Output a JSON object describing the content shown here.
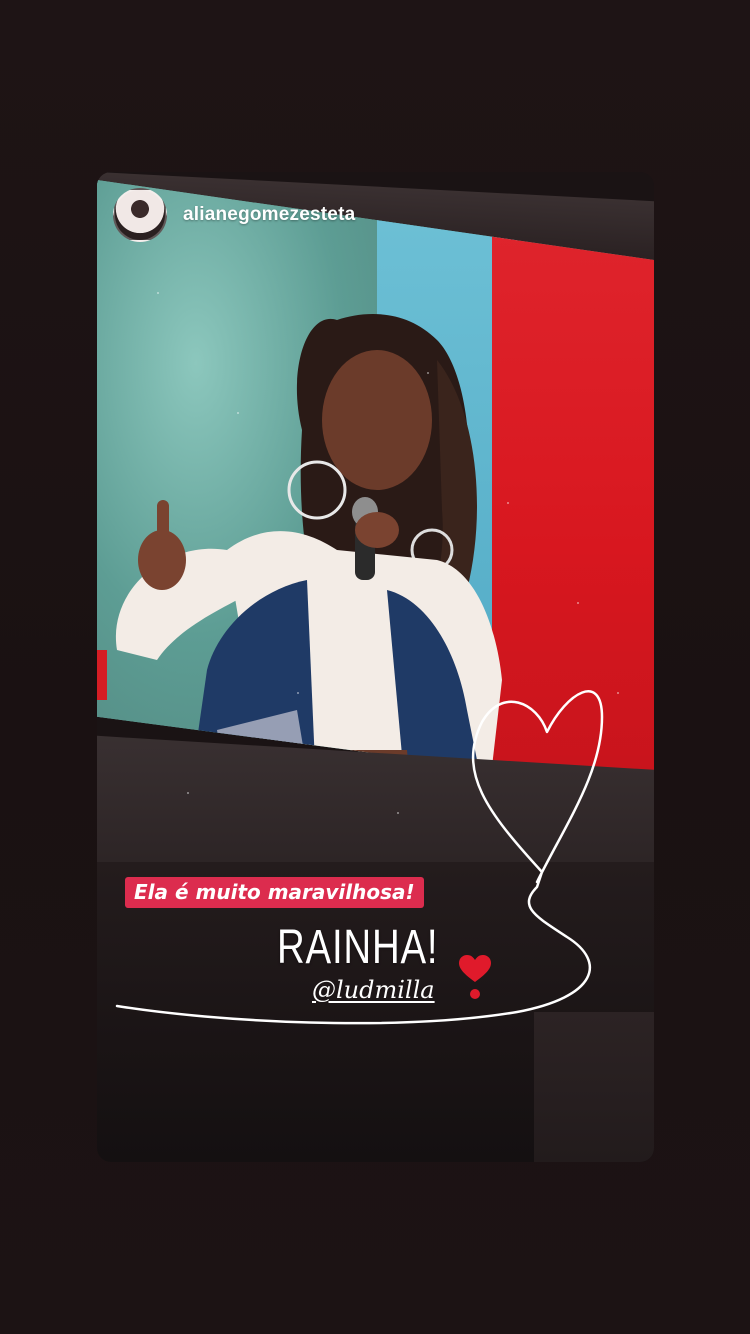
{
  "story": {
    "username": "alianegomezesteta",
    "avatar_icon": "profile-avatar",
    "caption": "Ela é muito maravilhosa!",
    "big_text": "RAINHA!",
    "mention": "@ludmilla",
    "heart_icon": "red-heart-exclamation-emoji",
    "doodle_icon": "hand-drawn-heart-doodle"
  },
  "colors": {
    "caption_bg": "#dc2c4e",
    "screen_red": "#d8171f",
    "background": "#1c1213"
  }
}
